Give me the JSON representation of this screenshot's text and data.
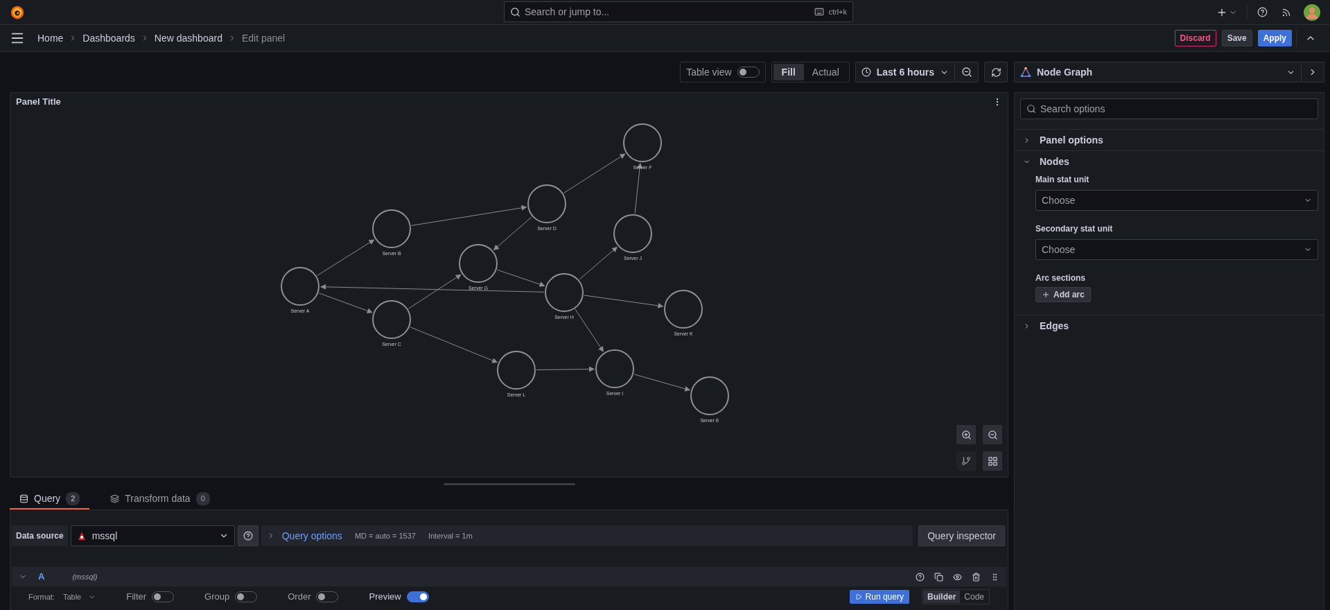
{
  "top_bar": {
    "search": {
      "placeholder": "Search or jump to...",
      "shortcut": "ctrl+k"
    }
  },
  "breadcrumbs": [
    {
      "label": "Home",
      "current": false
    },
    {
      "label": "Dashboards",
      "current": false
    },
    {
      "label": "New dashboard",
      "current": false
    },
    {
      "label": "Edit panel",
      "current": true
    }
  ],
  "actions": [
    {
      "label": "Discard",
      "kind": "danger"
    },
    {
      "label": "Save",
      "kind": "secondary"
    },
    {
      "label": "Apply",
      "kind": "primary"
    }
  ],
  "toolbar": {
    "table_view": {
      "label": "Table view",
      "on": false
    },
    "fill_modes": [
      {
        "label": "Fill",
        "selected": true
      },
      {
        "label": "Actual",
        "selected": false
      }
    ],
    "time_range": "Last 6 hours"
  },
  "panel": {
    "title": "Panel Title",
    "nodes": [
      {
        "label": "Server A"
      },
      {
        "label": "Server B"
      },
      {
        "label": "Server C"
      },
      {
        "label": "Server D"
      },
      {
        "label": "Server F"
      },
      {
        "label": "Server G"
      },
      {
        "label": "Server H"
      },
      {
        "label": "Server J"
      },
      {
        "label": "Server K"
      },
      {
        "label": "Server L"
      },
      {
        "label": "Server I"
      },
      {
        "label": "Server E"
      }
    ]
  },
  "visualization": {
    "name": "Node Graph"
  },
  "options": {
    "search_placeholder": "Search options",
    "sections": [
      {
        "title": "Panel options",
        "expanded": false
      },
      {
        "title": "Nodes",
        "expanded": true,
        "fields": [
          {
            "kind": "select",
            "label": "Main stat unit",
            "placeholder": "Choose"
          },
          {
            "kind": "select",
            "label": "Secondary stat unit",
            "placeholder": "Choose"
          },
          {
            "kind": "button",
            "label": "Arc sections",
            "button": "Add arc"
          }
        ]
      },
      {
        "title": "Edges",
        "expanded": false
      }
    ]
  },
  "query_tabs": [
    {
      "label": "Query",
      "count": "2",
      "selected": true
    },
    {
      "label": "Transform data",
      "count": "0",
      "selected": false
    }
  ],
  "data_source": {
    "label": "Data source",
    "value": "mssql"
  },
  "query_options": {
    "label": "Query options",
    "md": "MD = auto = 1537",
    "interval": "Interval = 1m"
  },
  "query_inspector": "Query inspector",
  "query": {
    "ref": "A",
    "source": "(mssql)",
    "expanded": true,
    "format_label": "Format:",
    "format": "Table",
    "toggles": [
      {
        "label": "Filter",
        "on": false
      },
      {
        "label": "Group",
        "on": false
      },
      {
        "label": "Order",
        "on": false
      },
      {
        "label": "Preview",
        "on": true
      }
    ],
    "run": "Run query",
    "modes": [
      {
        "label": "Builder",
        "selected": true
      },
      {
        "label": "Code",
        "selected": false
      }
    ]
  }
}
